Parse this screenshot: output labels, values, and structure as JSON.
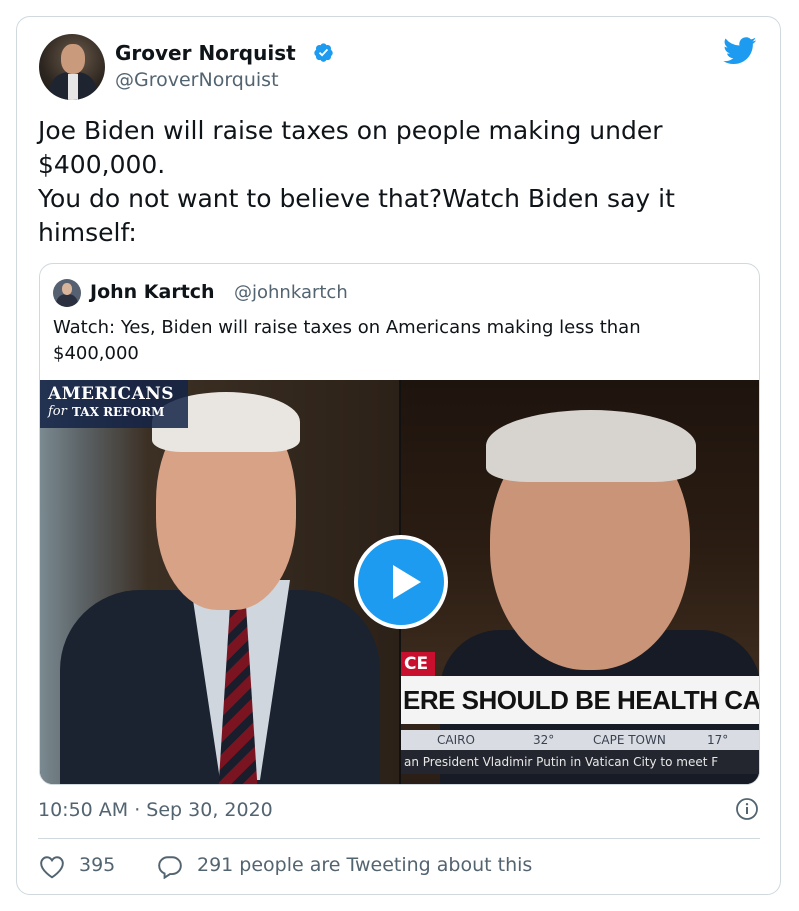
{
  "author": {
    "name": "Grover Norquist",
    "handle": "@GroverNorquist",
    "avatar_icon": "avatar-photo",
    "verified_icon": "verified-badge-icon",
    "brand_icon": "twitter-bird-icon",
    "brand_color": "#1d9bf0"
  },
  "tweet": {
    "lines": [
      "Joe Biden will raise taxes on people making under",
      "$400,000.",
      "You do not want to believe that?Watch Biden say it",
      "himself:"
    ]
  },
  "quoted_tweet": {
    "name": "John Kartch",
    "handle": "@johnkartch",
    "text_line1": "Watch: Yes, Biden will raise taxes on Americans making less than",
    "text_line2": "$400,000",
    "video": {
      "logo_line1": "AMERICANS",
      "logo_line2": "for",
      "logo_line3": "TAX REFORM",
      "chyron_red": "CE",
      "chyron_main": "ERE SHOULD BE HEALTH CARE FOR EV",
      "weather_city1": "CAIRO",
      "weather_temp1": "32°",
      "weather_city2": "CAPE TOWN",
      "weather_temp2": "17°",
      "ticker": "an President Vladimir Putin in Vatican City to meet F",
      "play_icon": "play-icon"
    }
  },
  "meta": {
    "timestamp": "10:50 AM · Sep 30, 2020",
    "info_icon": "info-icon"
  },
  "engagement": {
    "likes": "395",
    "replies_text": "291 people are Tweeting about this",
    "like_icon": "heart-icon",
    "reply_icon": "speech-bubble-icon"
  }
}
